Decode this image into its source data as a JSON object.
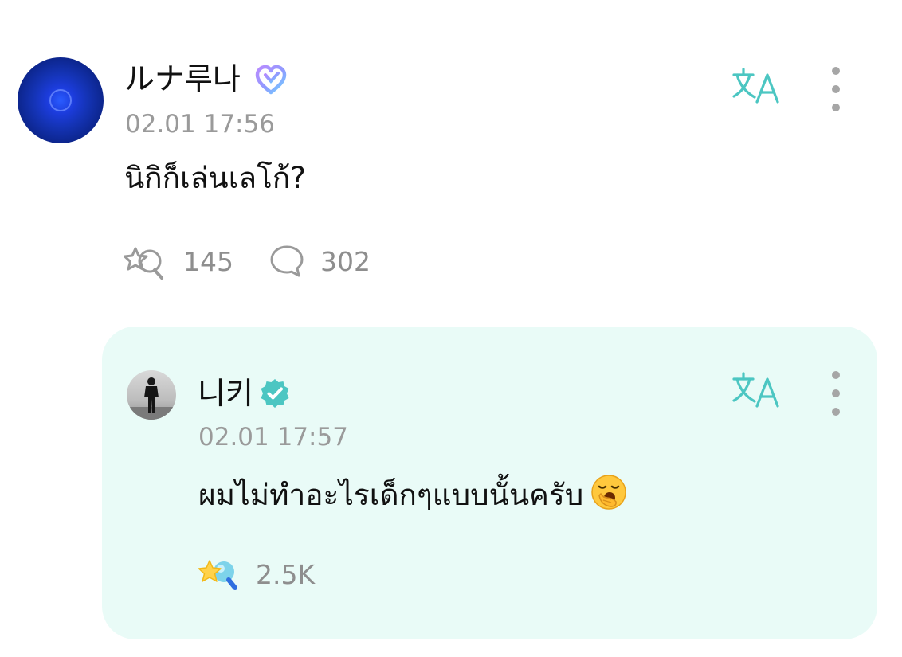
{
  "post": {
    "author_name": "ルナ루나",
    "timestamp": "02.01 17:56",
    "body": "นิกิก็เล่นเลโก้?",
    "reactions_count": "145",
    "comments_count": "302"
  },
  "reply": {
    "author_name": "니키",
    "timestamp": "02.01 17:57",
    "body": "ผมไม่ทำอะไรเด็กๆแบบนั้นครับ",
    "reactions_count": "2.5K"
  },
  "icons": {
    "translate": "translate-icon",
    "more": "more-vertical-icon",
    "reaction": "reaction-icon",
    "comment": "comment-bubble-icon",
    "fan_badge": "fan-heart-badge-icon",
    "verified": "verified-badge-icon",
    "emoji": "yawning-face-emoji"
  },
  "colors": {
    "accent_teal": "#4cc6c2",
    "reply_background": "#e9fbf7",
    "secondary_text": "#9a9a9a"
  }
}
